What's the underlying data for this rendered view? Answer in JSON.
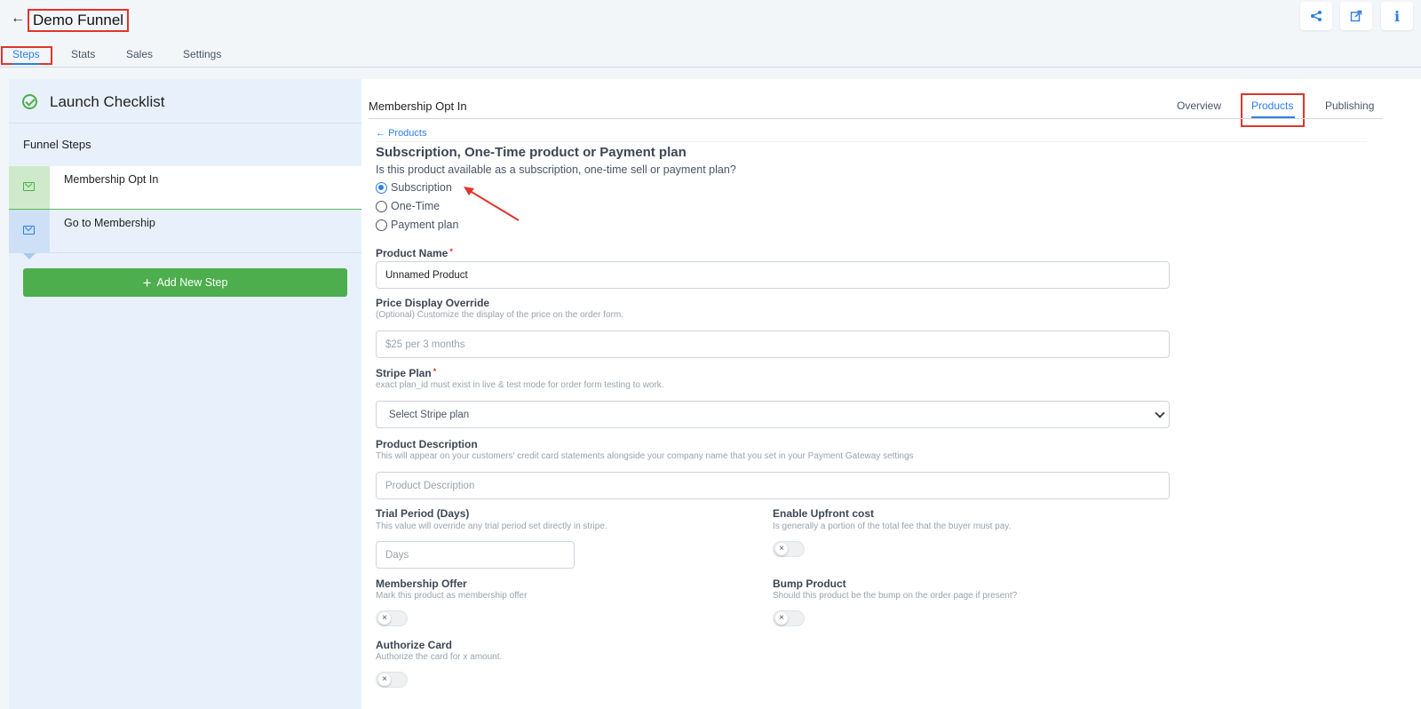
{
  "header": {
    "back_icon": "←",
    "title": "Demo Funnel",
    "actions": [
      "share-icon",
      "external-link-icon",
      "info-icon"
    ],
    "info_glyph": "i"
  },
  "top_tabs": [
    {
      "label": "Steps",
      "active": true
    },
    {
      "label": "Stats",
      "active": false
    },
    {
      "label": "Sales",
      "active": false
    },
    {
      "label": "Settings",
      "active": false
    }
  ],
  "sidebar": {
    "launch_title": "Launch Checklist",
    "funnel_steps_title": "Funnel Steps",
    "steps": [
      {
        "label": "Membership Opt In",
        "active": true
      },
      {
        "label": "Go to Membership",
        "active": false
      }
    ],
    "add_step_plus": "+",
    "add_step_label": "Add New Step"
  },
  "main": {
    "page_title": "Membership Opt In",
    "sub_tabs": [
      {
        "label": "Overview",
        "active": false
      },
      {
        "label": "Products",
        "active": true
      },
      {
        "label": "Publishing",
        "active": false
      }
    ],
    "breadcrumb": "Products",
    "section_title": "Subscription, One-Time product or Payment plan",
    "section_question": "Is this product available as a subscription, one-time sell or payment plan?",
    "radios": [
      {
        "label": "Subscription",
        "checked": true
      },
      {
        "label": "One-Time",
        "checked": false
      },
      {
        "label": "Payment plan",
        "checked": false
      }
    ],
    "product_name": {
      "label": "Product Name",
      "required_mark": "*",
      "value": "Unnamed Product"
    },
    "price_override": {
      "label": "Price Display Override",
      "hint": "(Optional) Customize the display of the price on the order form.",
      "placeholder": "$25 per 3 months"
    },
    "stripe_plan": {
      "label": "Stripe Plan",
      "required_mark": "*",
      "hint": "exact plan_id must exist in live & test mode for order form testing to work.",
      "selected": "Select Stripe plan"
    },
    "product_description": {
      "label": "Product Description",
      "hint": "This will appear on your customers' credit card statements alongside your company name that you set in your Payment Gateway settings",
      "placeholder": "Product Description"
    },
    "trial_period": {
      "label": "Trial Period (Days)",
      "hint": "This value will override any trial period set directly in stripe.",
      "placeholder": "Days"
    },
    "upfront_cost": {
      "label": "Enable Upfront cost",
      "hint": "Is generally a portion of the total fee that the buyer must pay.",
      "enabled": false
    },
    "membership_offer": {
      "label": "Membership Offer",
      "hint": "Mark this product as membership offer",
      "enabled": false
    },
    "bump_product": {
      "label": "Bump Product",
      "hint": "Should this product be the bump on the order page if present?",
      "enabled": false
    },
    "authorize_card": {
      "label": "Authorize Card",
      "hint": "Authorize the card for x amount.",
      "enabled": false
    }
  },
  "colors": {
    "accent": "#2b7ee8",
    "success": "#4cae4c",
    "highlight": "#e0352b"
  }
}
